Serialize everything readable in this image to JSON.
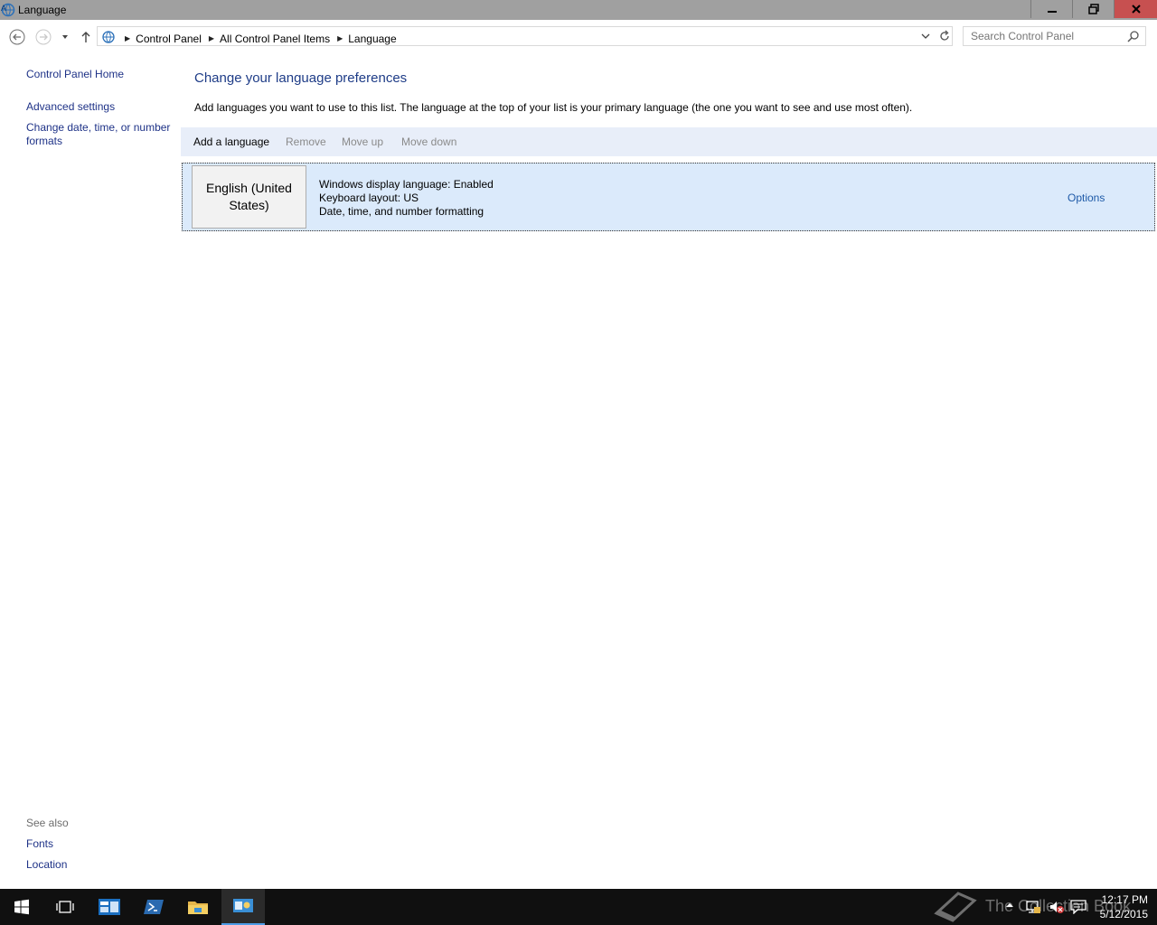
{
  "window": {
    "title": "Language"
  },
  "address_bar": {
    "breadcrumbs": [
      "Control Panel",
      "All Control Panel Items",
      "Language"
    ]
  },
  "search": {
    "placeholder": "Search Control Panel"
  },
  "left_pane": {
    "links": [
      "Control Panel Home",
      "Advanced settings",
      "Change date, time, or number",
      "formats"
    ],
    "see_also_label": "See also",
    "see_also_links": [
      "Fonts",
      "Location"
    ]
  },
  "main": {
    "heading": "Change your language preferences",
    "description": "Add languages you want to use to this list. The language at the top of your list is your primary language (the one you want to see and use most often).",
    "toolbar": {
      "add": "Add a language",
      "remove": "Remove",
      "move_up": "Move up",
      "move_down": "Move down"
    },
    "languages": [
      {
        "name": "English (United States)",
        "details": [
          "Windows display language: Enabled",
          "Keyboard layout: US",
          "Date, time, and number formatting"
        ],
        "options_label": "Options"
      }
    ]
  },
  "taskbar": {
    "watermark": "The Collection Book",
    "time": "12:17 PM",
    "date": "5/12/2015",
    "icons": [
      "windows-start-icon",
      "task-view-icon",
      "server-manager-icon",
      "powershell-icon",
      "file-explorer-icon",
      "control-panel-icon"
    ]
  },
  "colors": {
    "titlebar": "#a0a0a0",
    "close_button": "#c75050",
    "link": "#1e3287",
    "heading": "#1e3c87",
    "toolbar_bg": "#e8eef9",
    "selected_row": "#dbeafb",
    "taskbar": "#101010"
  }
}
